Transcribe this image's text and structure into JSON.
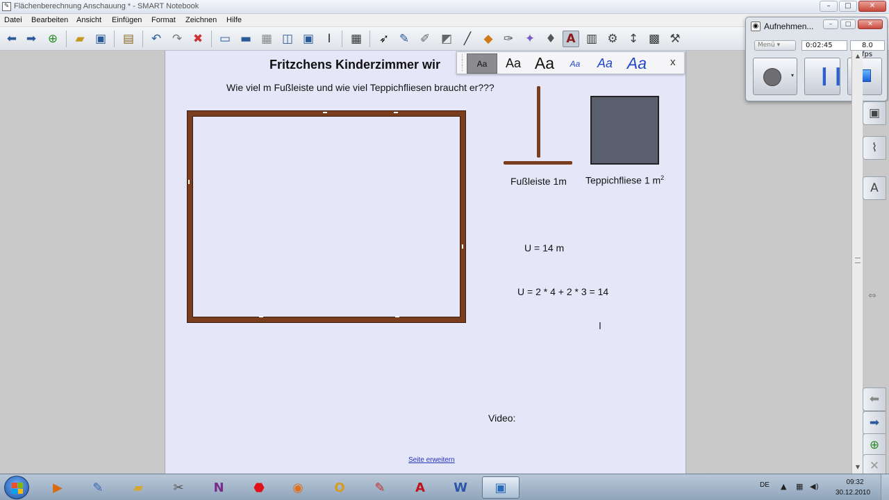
{
  "window": {
    "title": "Flächenberechnung Anschauung * - SMART Notebook",
    "minimize": "–",
    "maximize": "□",
    "close": "✕"
  },
  "menu": {
    "items": [
      "Datei",
      "Bearbeiten",
      "Ansicht",
      "Einfügen",
      "Format",
      "Zeichnen",
      "Hilfe"
    ]
  },
  "toolbar": {
    "icons": [
      "back-arrow-icon",
      "forward-arrow-icon",
      "add-page-icon",
      "open-folder-icon",
      "save-icon",
      "paste-icon",
      "undo-icon",
      "redo-icon",
      "delete-icon",
      "screen-shade-icon",
      "full-screen-icon",
      "transparent-bg-icon",
      "dual-page-icon",
      "screen-capture-icon",
      "text-cursor-icon",
      "table-icon",
      "select-arrow-icon",
      "pen-icon",
      "creative-pen-icon",
      "eraser-icon",
      "line-icon",
      "shapes-icon",
      "magic-pen-icon",
      "highlighter-icon",
      "fill-icon",
      "text-icon",
      "properties-icon",
      "measure-icon",
      "move-toolbar-icon",
      "video-icon",
      "extra-tools-icon"
    ]
  },
  "page": {
    "title": "Fritzchens Kinderzimmer wir",
    "question": "Wie viel m Fußleiste und wie viel Teppichfliesen braucht er???",
    "baseboard_label": "Fußleiste 1m",
    "tile_label": "Teppichfliese 1 m",
    "tile_label_sup": "2",
    "formula_u": "U = 14 m",
    "formula_calc": "U = 2 * 4 + 2 * 3 = 14",
    "text_cursor": "I",
    "video_label": "Video:",
    "extend_link": "Seite erweitern",
    "colors": {
      "baseboard": "#7a3d1e",
      "tile": "#5a5f6e",
      "page_bg": "#e6e6f9"
    }
  },
  "font_styles": {
    "samples": [
      "Aa",
      "Aa",
      "Aa",
      "Aa",
      "Aa",
      "Aa"
    ],
    "close": "x"
  },
  "recorder": {
    "title": "Aufnehmen...",
    "menu_label": "Menü",
    "elapsed": "0:02:45",
    "fps": "8.0 fps",
    "minimize": "–",
    "maximize": "□",
    "close": "✕"
  },
  "taskbar": {
    "apps": [
      "windows-media-player-icon",
      "paint-icon",
      "file-explorer-icon",
      "snipping-tool-icon",
      "onenote-icon",
      "stop-app-icon",
      "firefox-icon",
      "outlook-icon",
      "smart-notebook-icon",
      "acrobat-icon",
      "word-icon",
      "smart-recorder-icon"
    ],
    "language": "DE",
    "time": "09:32",
    "date": "30.12.2010"
  }
}
